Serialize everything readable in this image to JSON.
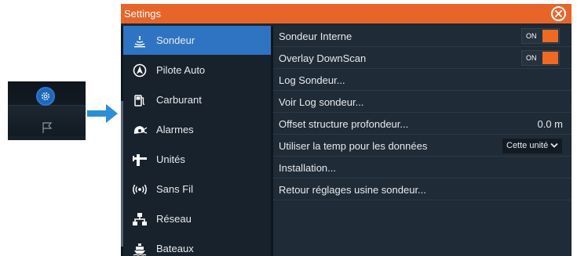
{
  "window": {
    "title": "Settings",
    "close_icon": "close-circle-icon"
  },
  "sidebar": {
    "items": [
      {
        "label": "Sondeur",
        "icon": "sonar-icon",
        "active": true
      },
      {
        "label": "Pilote Auto",
        "icon": "autopilot-icon",
        "active": false
      },
      {
        "label": "Carburant",
        "icon": "fuel-icon",
        "active": false
      },
      {
        "label": "Alarmes",
        "icon": "alarm-icon",
        "active": false
      },
      {
        "label": "Unités",
        "icon": "units-icon",
        "active": false
      },
      {
        "label": "Sans Fil",
        "icon": "wireless-icon",
        "active": false
      },
      {
        "label": "Réseau",
        "icon": "network-icon",
        "active": false
      },
      {
        "label": "Bateaux",
        "icon": "vessels-icon",
        "active": false
      }
    ]
  },
  "settings": {
    "rows": [
      {
        "label": "Sondeur Interne",
        "toggle": "ON"
      },
      {
        "label": "Overlay DownScan",
        "toggle": "ON"
      },
      {
        "label": "Log Sondeur..."
      },
      {
        "label": "Voir Log sondeur..."
      },
      {
        "label": "Offset structure profondeur...",
        "value": "0.0 m"
      },
      {
        "label": "Utiliser la temp pour les données",
        "select": "Cette unité"
      },
      {
        "label": "Installation..."
      },
      {
        "label": "Retour réglages usine sondeur..."
      }
    ]
  },
  "colors": {
    "titlebar": "#e8652a",
    "active_item": "#2f74c3",
    "toggle_on": "#ee6a22",
    "arrow": "#2b8fd6"
  }
}
